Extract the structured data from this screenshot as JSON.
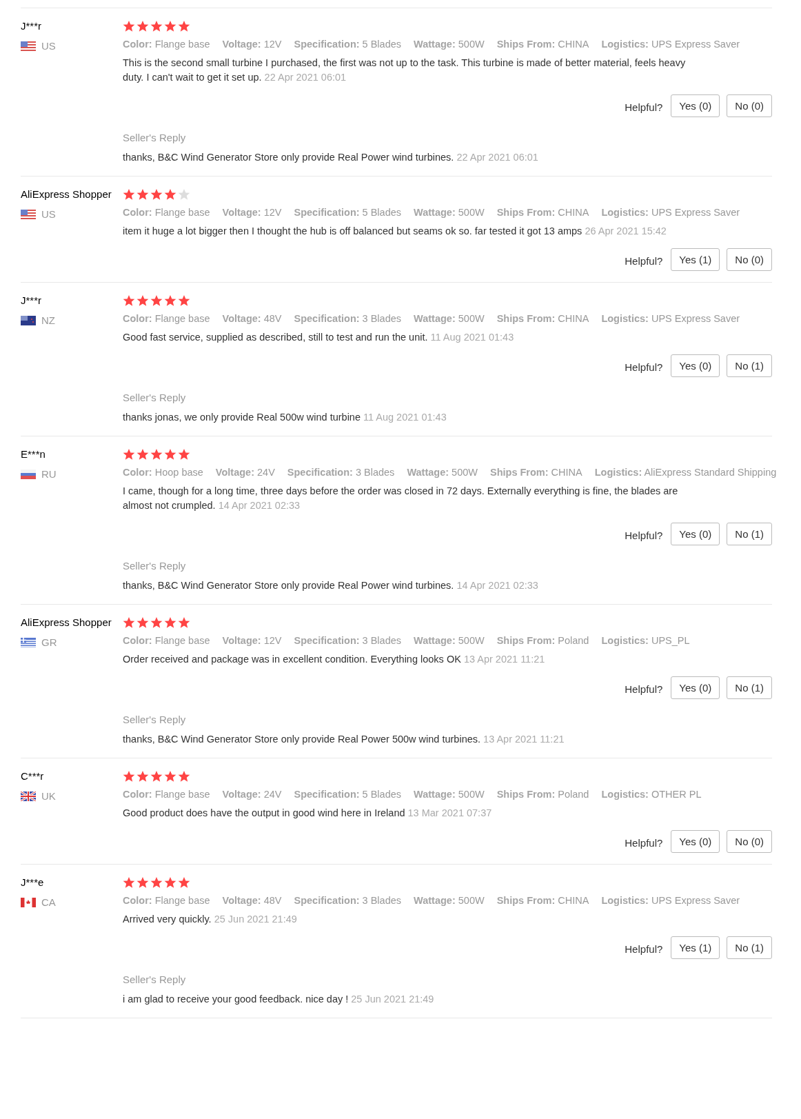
{
  "reviews": [
    {
      "name": "J***r",
      "flag": {
        "kind": "us"
      },
      "country": "US",
      "stars": 5,
      "attributes": [
        {
          "label": "Color:",
          "value": "Flange base"
        },
        {
          "label": "Voltage:",
          "value": "12V"
        },
        {
          "label": "Specification:",
          "value": "5 Blades"
        },
        {
          "label": "Wattage:",
          "value": "500W"
        },
        {
          "label": "Ships From:",
          "value": "CHINA"
        },
        {
          "label": "Logistics:",
          "value": "UPS Express Saver"
        }
      ],
      "text": "This is the second small turbine I purchased, the first was not up to the task. This turbine is made of better material, feels heavy duty. I can't wait to get it set up.",
      "date": "22 Apr 2021 06:01",
      "helpful_label": "Helpful?",
      "yes": "Yes (0)",
      "no": "No (0)",
      "reply": {
        "title": "Seller's Reply",
        "text": "thanks, B&C Wind Generator Store only provide Real Power wind turbines.",
        "date": "22 Apr 2021 06:01"
      }
    },
    {
      "name": "AliExpress Shopper",
      "flag": {
        "kind": "us"
      },
      "country": "US",
      "stars": 4,
      "attributes": [
        {
          "label": "Color:",
          "value": "Flange base"
        },
        {
          "label": "Voltage:",
          "value": "12V"
        },
        {
          "label": "Specification:",
          "value": "5 Blades"
        },
        {
          "label": "Wattage:",
          "value": "500W"
        },
        {
          "label": "Ships From:",
          "value": "CHINA"
        },
        {
          "label": "Logistics:",
          "value": "UPS Express Saver"
        }
      ],
      "text": "item it huge a lot bigger then I thought the hub is off balanced but seams ok so. far tested it got 13 amps",
      "date": "26 Apr 2021 15:42",
      "helpful_label": "Helpful?",
      "yes": "Yes (1)",
      "no": "No (0)"
    },
    {
      "name": "J***r",
      "flag": {
        "kind": "nz"
      },
      "country": "NZ",
      "stars": 5,
      "attributes": [
        {
          "label": "Color:",
          "value": "Flange base"
        },
        {
          "label": "Voltage:",
          "value": "48V"
        },
        {
          "label": "Specification:",
          "value": "3 Blades"
        },
        {
          "label": "Wattage:",
          "value": "500W"
        },
        {
          "label": "Ships From:",
          "value": "CHINA"
        },
        {
          "label": "Logistics:",
          "value": "UPS Express Saver"
        }
      ],
      "text": "Good fast service, supplied as described, still to test and run the unit.",
      "date": "11 Aug 2021 01:43",
      "helpful_label": "Helpful?",
      "yes": "Yes (0)",
      "no": "No (1)",
      "reply": {
        "title": "Seller's Reply",
        "text": "thanks jonas, we only provide Real 500w wind turbine",
        "date": "11 Aug 2021 01:43"
      }
    },
    {
      "name": "E***n",
      "flag": {
        "kind": "ru"
      },
      "country": "RU",
      "stars": 5,
      "attributes": [
        {
          "label": "Color:",
          "value": "Hoop base"
        },
        {
          "label": "Voltage:",
          "value": "24V"
        },
        {
          "label": "Specification:",
          "value": "3 Blades"
        },
        {
          "label": "Wattage:",
          "value": "500W"
        },
        {
          "label": "Ships From:",
          "value": "CHINA"
        },
        {
          "label": "Logistics:",
          "value": "AliExpress Standard Shipping"
        }
      ],
      "text": "I came, though for a long time, three days before the order was closed in 72 days. Externally everything is fine, the blades are almost not crumpled.",
      "date": "14 Apr 2021 02:33",
      "helpful_label": "Helpful?",
      "yes": "Yes (0)",
      "no": "No (1)",
      "reply": {
        "title": "Seller's Reply",
        "text": "thanks, B&C Wind Generator Store only provide Real Power wind turbines.",
        "date": "14 Apr 2021 02:33"
      }
    },
    {
      "name": "AliExpress Shopper",
      "flag": {
        "kind": "gr"
      },
      "country": "GR",
      "stars": 5,
      "attributes": [
        {
          "label": "Color:",
          "value": "Flange base"
        },
        {
          "label": "Voltage:",
          "value": "12V"
        },
        {
          "label": "Specification:",
          "value": "3 Blades"
        },
        {
          "label": "Wattage:",
          "value": "500W"
        },
        {
          "label": "Ships From:",
          "value": "Poland"
        },
        {
          "label": "Logistics:",
          "value": "UPS_PL"
        }
      ],
      "text": "Order received and package was in excellent condition. Everything looks OK",
      "date": "13 Apr 2021 11:21",
      "helpful_label": "Helpful?",
      "yes": "Yes (0)",
      "no": "No (1)",
      "reply": {
        "title": "Seller's Reply",
        "text": "thanks, B&C Wind Generator Store only provide Real Power 500w wind turbines.",
        "date": "13 Apr 2021 11:21"
      }
    },
    {
      "name": "C***r",
      "flag": {
        "kind": "uk"
      },
      "country": "UK",
      "stars": 5,
      "attributes": [
        {
          "label": "Color:",
          "value": "Flange base"
        },
        {
          "label": "Voltage:",
          "value": "24V"
        },
        {
          "label": "Specification:",
          "value": "5 Blades"
        },
        {
          "label": "Wattage:",
          "value": "500W"
        },
        {
          "label": "Ships From:",
          "value": "Poland"
        },
        {
          "label": "Logistics:",
          "value": "OTHER PL"
        }
      ],
      "text": "Good product does have the output in good wind here in Ireland",
      "date": "13 Mar 2021 07:37",
      "helpful_label": "Helpful?",
      "yes": "Yes (0)",
      "no": "No (0)"
    },
    {
      "name": "J***e",
      "flag": {
        "kind": "ca"
      },
      "country": "CA",
      "stars": 5,
      "attributes": [
        {
          "label": "Color:",
          "value": "Flange base"
        },
        {
          "label": "Voltage:",
          "value": "48V"
        },
        {
          "label": "Specification:",
          "value": "3 Blades"
        },
        {
          "label": "Wattage:",
          "value": "500W"
        },
        {
          "label": "Ships From:",
          "value": "CHINA"
        },
        {
          "label": "Logistics:",
          "value": "UPS Express Saver"
        }
      ],
      "text": "Arrived very quickly.",
      "date": "25 Jun 2021 21:49",
      "helpful_label": "Helpful?",
      "yes": "Yes (1)",
      "no": "No (1)",
      "reply": {
        "title": "Seller's Reply",
        "text": "i am glad to receive your good feedback. nice day !",
        "date": "25 Jun 2021 21:49"
      }
    }
  ]
}
